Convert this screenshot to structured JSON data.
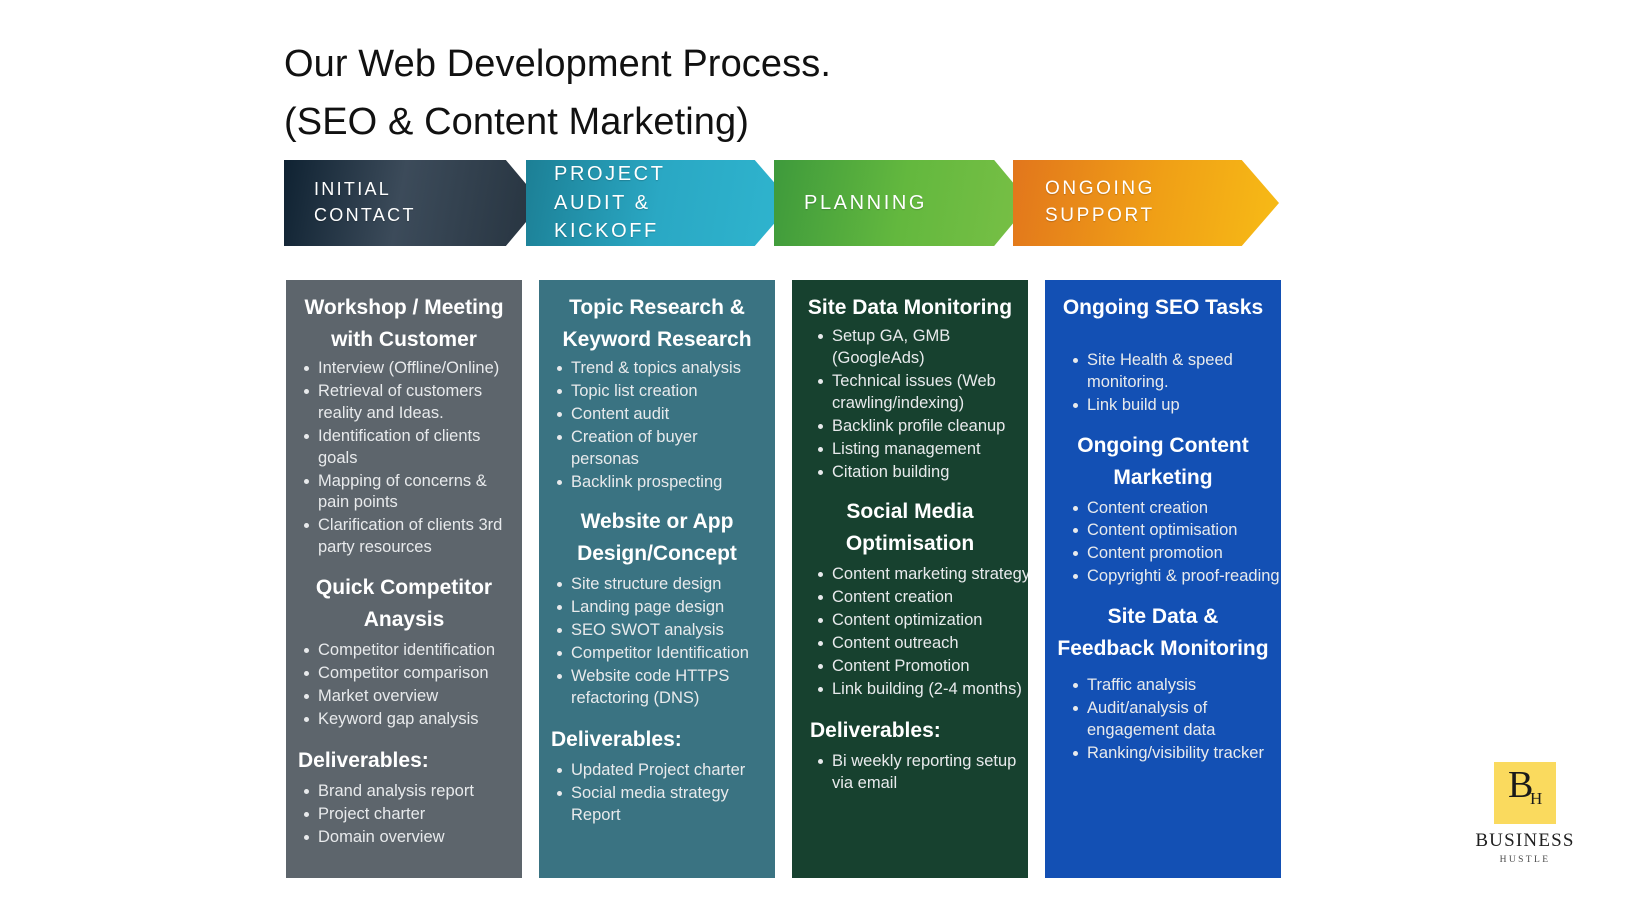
{
  "title": {
    "line1": "Our Web Development Process.",
    "line2": "(SEO & Content Marketing)"
  },
  "process_steps": [
    {
      "label": "INITIAL CONTACT",
      "color": "#26333f"
    },
    {
      "label": "PROJECT AUDIT & KICKOFF",
      "color": "#2aa8c4"
    },
    {
      "label": "PLANNING",
      "color": "#63b83e"
    },
    {
      "label": "ONGOING SUPPORT",
      "color": "#f0a016"
    }
  ],
  "columns": [
    {
      "bg": "#5d656c",
      "heading": "Workshop / Meeting with Customer",
      "items": [
        "Interview (Offline/Online)",
        "Retrieval of customers reality and Ideas.",
        "Identification of clients goals",
        "Mapping of concerns & pain points",
        "Clarification of clients 3rd party resources"
      ],
      "subheading": "Quick Competitor Anaysis",
      "sub_items": [
        "Competitor identification",
        "Competitor comparison",
        "Market overview",
        "Keyword gap analysis"
      ],
      "deliverables_label": "Deliverables:",
      "deliverables": [
        "Brand analysis report",
        "Project charter",
        "Domain overview"
      ]
    },
    {
      "bg": "#3a7382",
      "heading": "Topic Research & Keyword Research",
      "items": [
        "Trend & topics analysis",
        "Topic list creation",
        "Content audit",
        "Creation of buyer personas",
        "Backlink prospecting"
      ],
      "subheading": "Website or App Design/Concept",
      "sub_items": [
        "Site structure design",
        "Landing page design",
        "SEO SWOT analysis",
        "Competitor Identification",
        "Website code HTTPS refactoring (DNS)"
      ],
      "deliverables_label": "Deliverables:",
      "deliverables": [
        "Updated Project charter",
        "Social media strategy Report"
      ]
    },
    {
      "bg": "#17412f",
      "heading": "Site Data Monitoring",
      "items": [
        "Setup GA, GMB (GoogleAds)",
        "Technical issues (Web crawling/indexing)",
        "Backlink profile cleanup",
        "Listing management",
        "Citation building"
      ],
      "subheading": "Social Media Optimisation",
      "sub_items": [
        "Content marketing strategy",
        "Content creation",
        "Content optimization",
        "Content outreach",
        "Content Promotion",
        "Link building (2-4 months)"
      ],
      "deliverables_label": "Deliverables:",
      "deliverables": [
        "Bi weekly reporting setup via email"
      ]
    },
    {
      "bg": "#1350b4",
      "heading": "Ongoing SEO Tasks",
      "items": [
        "Site Health & speed monitoring.",
        "Link build up"
      ],
      "subheading": "Ongoing Content Marketing",
      "sub_items": [
        "Content creation",
        "Content optimisation",
        "Content promotion",
        "Copyrighti & proof-reading"
      ],
      "subheading2": "Site Data & Feedback Monitoring",
      "sub_items2": [
        "Traffic analysis",
        "Audit/analysis of engagement data",
        "Ranking/visibility tracker"
      ]
    }
  ],
  "logo": {
    "mark_letter": "B",
    "mark_letter_small": "H",
    "name": "BUSINESS",
    "sub": "HUSTLE",
    "color": "#fada5e"
  }
}
